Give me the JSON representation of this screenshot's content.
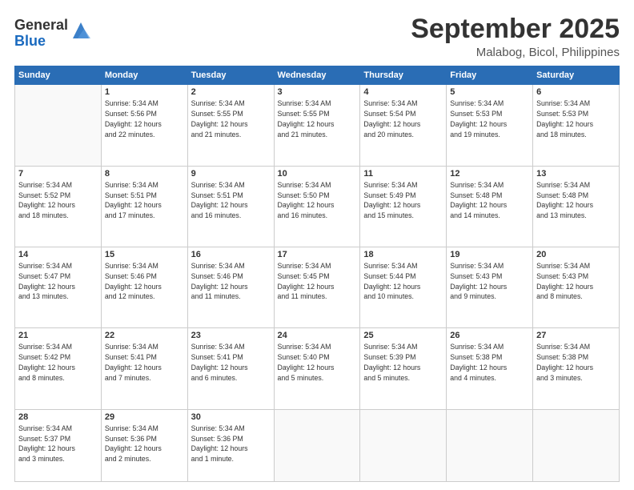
{
  "logo": {
    "general": "General",
    "blue": "Blue"
  },
  "header": {
    "month": "September 2025",
    "location": "Malabog, Bicol, Philippines"
  },
  "weekdays": [
    "Sunday",
    "Monday",
    "Tuesday",
    "Wednesday",
    "Thursday",
    "Friday",
    "Saturday"
  ],
  "weeks": [
    [
      {
        "day": "",
        "info": ""
      },
      {
        "day": "1",
        "info": "Sunrise: 5:34 AM\nSunset: 5:56 PM\nDaylight: 12 hours\nand 22 minutes."
      },
      {
        "day": "2",
        "info": "Sunrise: 5:34 AM\nSunset: 5:55 PM\nDaylight: 12 hours\nand 21 minutes."
      },
      {
        "day": "3",
        "info": "Sunrise: 5:34 AM\nSunset: 5:55 PM\nDaylight: 12 hours\nand 21 minutes."
      },
      {
        "day": "4",
        "info": "Sunrise: 5:34 AM\nSunset: 5:54 PM\nDaylight: 12 hours\nand 20 minutes."
      },
      {
        "day": "5",
        "info": "Sunrise: 5:34 AM\nSunset: 5:53 PM\nDaylight: 12 hours\nand 19 minutes."
      },
      {
        "day": "6",
        "info": "Sunrise: 5:34 AM\nSunset: 5:53 PM\nDaylight: 12 hours\nand 18 minutes."
      }
    ],
    [
      {
        "day": "7",
        "info": "Sunrise: 5:34 AM\nSunset: 5:52 PM\nDaylight: 12 hours\nand 18 minutes."
      },
      {
        "day": "8",
        "info": "Sunrise: 5:34 AM\nSunset: 5:51 PM\nDaylight: 12 hours\nand 17 minutes."
      },
      {
        "day": "9",
        "info": "Sunrise: 5:34 AM\nSunset: 5:51 PM\nDaylight: 12 hours\nand 16 minutes."
      },
      {
        "day": "10",
        "info": "Sunrise: 5:34 AM\nSunset: 5:50 PM\nDaylight: 12 hours\nand 16 minutes."
      },
      {
        "day": "11",
        "info": "Sunrise: 5:34 AM\nSunset: 5:49 PM\nDaylight: 12 hours\nand 15 minutes."
      },
      {
        "day": "12",
        "info": "Sunrise: 5:34 AM\nSunset: 5:48 PM\nDaylight: 12 hours\nand 14 minutes."
      },
      {
        "day": "13",
        "info": "Sunrise: 5:34 AM\nSunset: 5:48 PM\nDaylight: 12 hours\nand 13 minutes."
      }
    ],
    [
      {
        "day": "14",
        "info": "Sunrise: 5:34 AM\nSunset: 5:47 PM\nDaylight: 12 hours\nand 13 minutes."
      },
      {
        "day": "15",
        "info": "Sunrise: 5:34 AM\nSunset: 5:46 PM\nDaylight: 12 hours\nand 12 minutes."
      },
      {
        "day": "16",
        "info": "Sunrise: 5:34 AM\nSunset: 5:46 PM\nDaylight: 12 hours\nand 11 minutes."
      },
      {
        "day": "17",
        "info": "Sunrise: 5:34 AM\nSunset: 5:45 PM\nDaylight: 12 hours\nand 11 minutes."
      },
      {
        "day": "18",
        "info": "Sunrise: 5:34 AM\nSunset: 5:44 PM\nDaylight: 12 hours\nand 10 minutes."
      },
      {
        "day": "19",
        "info": "Sunrise: 5:34 AM\nSunset: 5:43 PM\nDaylight: 12 hours\nand 9 minutes."
      },
      {
        "day": "20",
        "info": "Sunrise: 5:34 AM\nSunset: 5:43 PM\nDaylight: 12 hours\nand 8 minutes."
      }
    ],
    [
      {
        "day": "21",
        "info": "Sunrise: 5:34 AM\nSunset: 5:42 PM\nDaylight: 12 hours\nand 8 minutes."
      },
      {
        "day": "22",
        "info": "Sunrise: 5:34 AM\nSunset: 5:41 PM\nDaylight: 12 hours\nand 7 minutes."
      },
      {
        "day": "23",
        "info": "Sunrise: 5:34 AM\nSunset: 5:41 PM\nDaylight: 12 hours\nand 6 minutes."
      },
      {
        "day": "24",
        "info": "Sunrise: 5:34 AM\nSunset: 5:40 PM\nDaylight: 12 hours\nand 5 minutes."
      },
      {
        "day": "25",
        "info": "Sunrise: 5:34 AM\nSunset: 5:39 PM\nDaylight: 12 hours\nand 5 minutes."
      },
      {
        "day": "26",
        "info": "Sunrise: 5:34 AM\nSunset: 5:38 PM\nDaylight: 12 hours\nand 4 minutes."
      },
      {
        "day": "27",
        "info": "Sunrise: 5:34 AM\nSunset: 5:38 PM\nDaylight: 12 hours\nand 3 minutes."
      }
    ],
    [
      {
        "day": "28",
        "info": "Sunrise: 5:34 AM\nSunset: 5:37 PM\nDaylight: 12 hours\nand 3 minutes."
      },
      {
        "day": "29",
        "info": "Sunrise: 5:34 AM\nSunset: 5:36 PM\nDaylight: 12 hours\nand 2 minutes."
      },
      {
        "day": "30",
        "info": "Sunrise: 5:34 AM\nSunset: 5:36 PM\nDaylight: 12 hours\nand 1 minute."
      },
      {
        "day": "",
        "info": ""
      },
      {
        "day": "",
        "info": ""
      },
      {
        "day": "",
        "info": ""
      },
      {
        "day": "",
        "info": ""
      }
    ]
  ]
}
